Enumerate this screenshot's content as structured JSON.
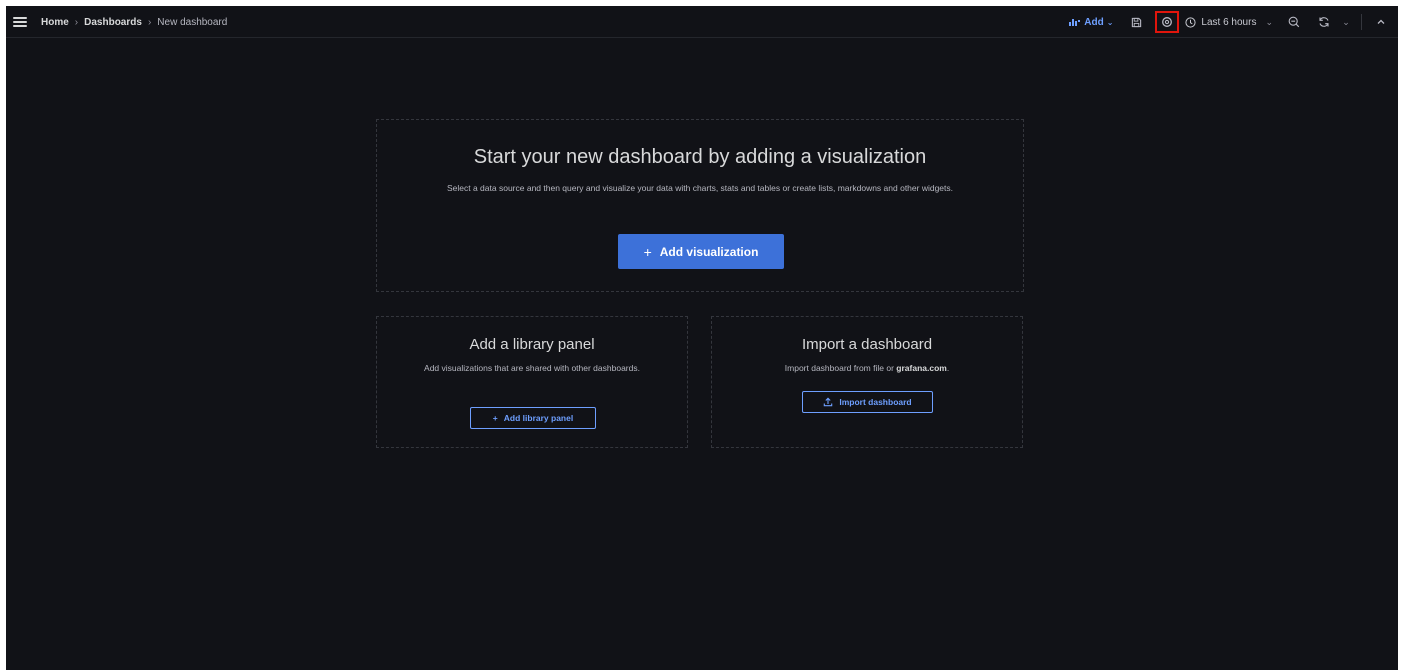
{
  "breadcrumb": {
    "home": "Home",
    "separator": "›",
    "dashboards": "Dashboards",
    "current": "New dashboard"
  },
  "toolbar": {
    "add_label": "Add",
    "caret": "⌄",
    "time_range": "Last 6 hours",
    "icons": [
      "save-icon",
      "settings-icon",
      "clock-icon",
      "zoom-out-icon",
      "refresh-icon",
      "collapse-icon"
    ],
    "highlight_color": "#e0150c"
  },
  "main": {
    "title": "Start your new dashboard by adding a visualization",
    "description": "Select a data source and then query and visualize your data with charts, stats and tables or create lists, markdowns and other widgets.",
    "button_plus": "+",
    "button_label": "Add visualization",
    "button_color": "#3d71d9"
  },
  "library_panel": {
    "title": "Add a library panel",
    "description": "Add visualizations that are shared with other dashboards.",
    "button_plus": "+",
    "button_label": "Add library panel"
  },
  "import": {
    "title": "Import a dashboard",
    "description_prefix": "Import dashboard from file or ",
    "description_link": "grafana.com",
    "description_suffix": ".",
    "button_label": "Import dashboard"
  }
}
